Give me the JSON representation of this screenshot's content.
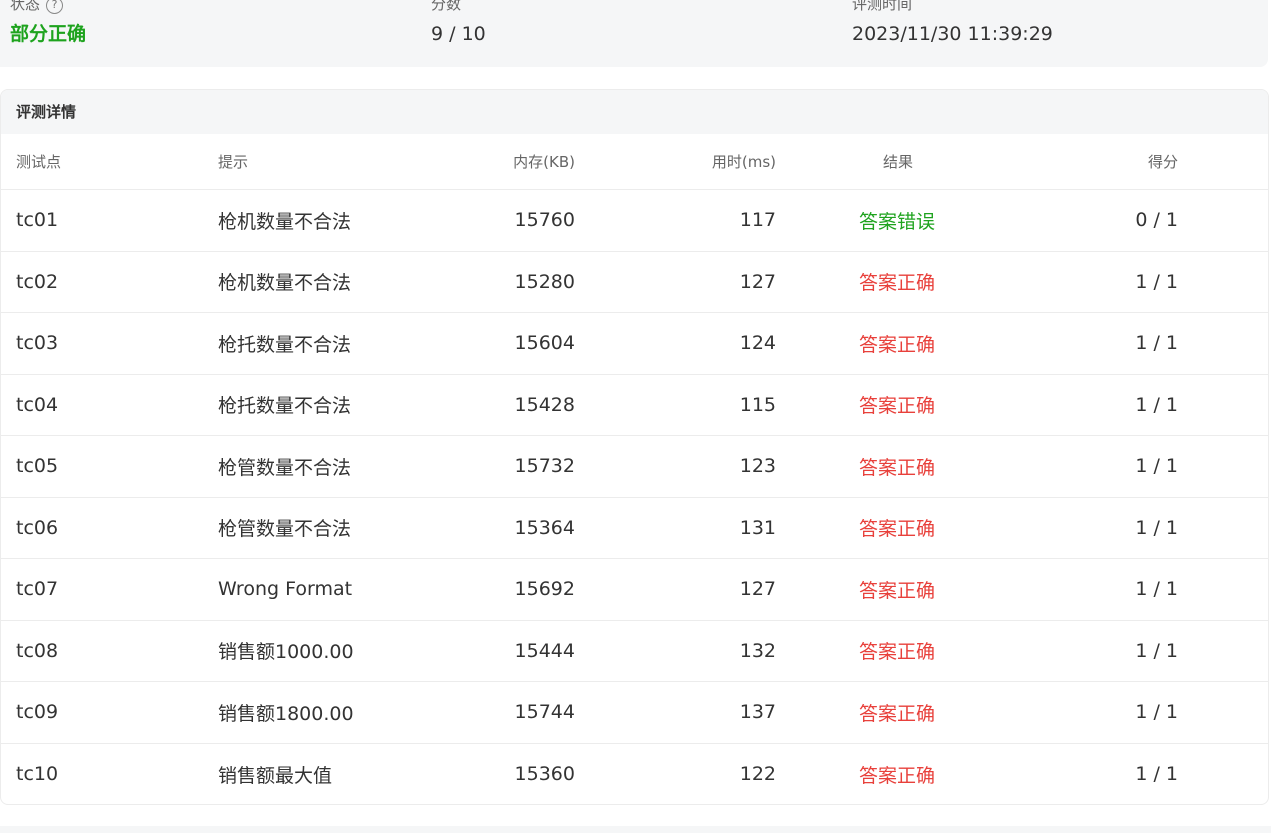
{
  "summary": {
    "status_label": "状态",
    "status_value": "部分正确",
    "score_label": "分数",
    "score_value": "9 / 10",
    "time_label": "评测时间",
    "time_value": "2023/11/30 11:39:29",
    "help_glyph": "?"
  },
  "details": {
    "title": "评测详情",
    "columns": {
      "case": "测试点",
      "hint": "提示",
      "memory": "内存(KB)",
      "time": "用时(ms)",
      "result": "结果",
      "score": "得分"
    },
    "rows": [
      {
        "case": "tc01",
        "hint": "枪机数量不合法",
        "memory": "15760",
        "time": "117",
        "result": "答案错误",
        "score": "0 / 1"
      },
      {
        "case": "tc02",
        "hint": "枪机数量不合法",
        "memory": "15280",
        "time": "127",
        "result": "答案正确",
        "score": "1 / 1"
      },
      {
        "case": "tc03",
        "hint": "枪托数量不合法",
        "memory": "15604",
        "time": "124",
        "result": "答案正确",
        "score": "1 / 1"
      },
      {
        "case": "tc04",
        "hint": "枪托数量不合法",
        "memory": "15428",
        "time": "115",
        "result": "答案正确",
        "score": "1 / 1"
      },
      {
        "case": "tc05",
        "hint": "枪管数量不合法",
        "memory": "15732",
        "time": "123",
        "result": "答案正确",
        "score": "1 / 1"
      },
      {
        "case": "tc06",
        "hint": "枪管数量不合法",
        "memory": "15364",
        "time": "131",
        "result": "答案正确",
        "score": "1 / 1"
      },
      {
        "case": "tc07",
        "hint": "Wrong Format",
        "memory": "15692",
        "time": "127",
        "result": "答案正确",
        "score": "1 / 1"
      },
      {
        "case": "tc08",
        "hint": "销售额1000.00",
        "memory": "15444",
        "time": "132",
        "result": "答案正确",
        "score": "1 / 1"
      },
      {
        "case": "tc09",
        "hint": "销售额1800.00",
        "memory": "15744",
        "time": "137",
        "result": "答案正确",
        "score": "1 / 1"
      },
      {
        "case": "tc10",
        "hint": "销售额最大值",
        "memory": "15360",
        "time": "122",
        "result": "答案正确",
        "score": "1 / 1"
      }
    ]
  },
  "colors": {
    "accepted": "#e8403b",
    "wrong_answer": "#1ea31e",
    "partial_status": "#1ea31e",
    "card_background": "#f5f6f7"
  },
  "icons": {
    "help": "question-circle-icon"
  }
}
